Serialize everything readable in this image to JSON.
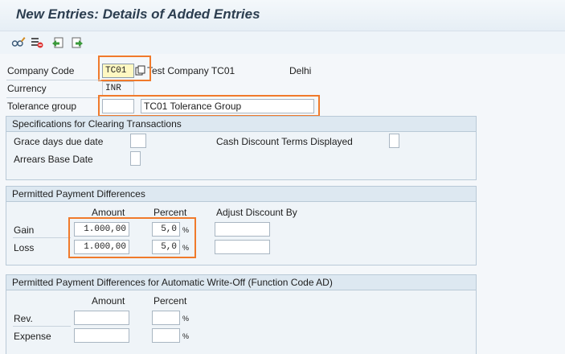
{
  "title": "New Entries: Details of Added Entries",
  "toolbar": {
    "icons": [
      "glasses-icon",
      "delete-row-icon",
      "undo-icon",
      "next-entry-icon"
    ]
  },
  "header": {
    "company_code_label": "Company Code",
    "company_code_value": "TC01",
    "company_name": "Test Company TC01",
    "city": "Delhi",
    "currency_label": "Currency",
    "currency_value": "INR",
    "tolerance_group_label": "Tolerance group",
    "tolerance_group_value": "",
    "tolerance_group_text": "TC01 Tolerance Group"
  },
  "clearing": {
    "title": "Specifications for Clearing Transactions",
    "grace_days_label": "Grace days due date",
    "grace_days_value": "",
    "cash_discount_label": "Cash Discount Terms Displayed",
    "cash_discount_value": "",
    "arrears_label": "Arrears Base Date",
    "arrears_value": ""
  },
  "payment_diff": {
    "title": "Permitted Payment Differences",
    "col_amount": "Amount",
    "col_percent": "Percent",
    "col_adjust": "Adjust Discount By",
    "pct_symbol": "%",
    "rows": [
      {
        "label": "Gain",
        "amount": "1.000,00",
        "percent": "5,0",
        "adjust": ""
      },
      {
        "label": "Loss",
        "amount": "1.000,00",
        "percent": "5,0",
        "adjust": ""
      }
    ]
  },
  "writeoff": {
    "title": "Permitted Payment Differences for Automatic Write-Off (Function Code AD)",
    "col_amount": "Amount",
    "col_percent": "Percent",
    "pct_symbol": "%",
    "rows": [
      {
        "label": "Rev.",
        "amount": "",
        "percent": ""
      },
      {
        "label": "Expense",
        "amount": "",
        "percent": ""
      }
    ]
  },
  "colors": {
    "highlight": "#f07a2b",
    "input_focus": "#fff8c2",
    "group_header": "#dde8f1"
  }
}
